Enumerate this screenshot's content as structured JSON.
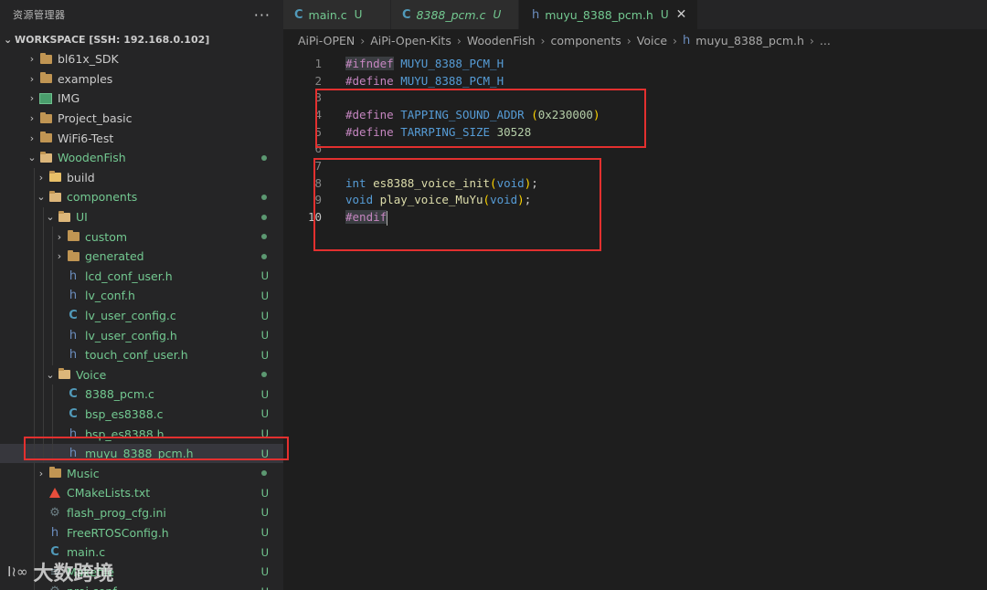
{
  "explorer": {
    "title": "资源管理器",
    "more": "···",
    "workspace": "WORKSPACE [SSH: 192.168.0.102]"
  },
  "tree": [
    {
      "name": "bl61x_SDK",
      "kind": "folder",
      "depth": 1,
      "chev": "›",
      "status": ""
    },
    {
      "name": "examples",
      "kind": "folder",
      "depth": 1,
      "chev": "›",
      "status": ""
    },
    {
      "name": "IMG",
      "kind": "img-folder",
      "depth": 1,
      "chev": "›",
      "status": ""
    },
    {
      "name": "Project_basic",
      "kind": "folder",
      "depth": 1,
      "chev": "›",
      "status": ""
    },
    {
      "name": "WiFi6-Test",
      "kind": "folder",
      "depth": 1,
      "chev": "›",
      "status": ""
    },
    {
      "name": "WoodenFish",
      "kind": "folder-open",
      "depth": 1,
      "chev": "⌄",
      "status": "dot"
    },
    {
      "name": "build",
      "kind": "build-folder",
      "depth": 2,
      "chev": "›",
      "status": ""
    },
    {
      "name": "components",
      "kind": "folder-open",
      "depth": 2,
      "chev": "⌄",
      "status": "dot"
    },
    {
      "name": "UI",
      "kind": "folder-open",
      "depth": 3,
      "chev": "⌄",
      "status": "dot"
    },
    {
      "name": "custom",
      "kind": "folder",
      "depth": 4,
      "chev": "›",
      "status": "dot"
    },
    {
      "name": "generated",
      "kind": "folder",
      "depth": 4,
      "chev": "›",
      "status": "dot"
    },
    {
      "name": "lcd_conf_user.h",
      "kind": "h",
      "depth": 4,
      "chev": "",
      "status": "U"
    },
    {
      "name": "lv_conf.h",
      "kind": "h",
      "depth": 4,
      "chev": "",
      "status": "U"
    },
    {
      "name": "lv_user_config.c",
      "kind": "c",
      "depth": 4,
      "chev": "",
      "status": "U"
    },
    {
      "name": "lv_user_config.h",
      "kind": "h",
      "depth": 4,
      "chev": "",
      "status": "U"
    },
    {
      "name": "touch_conf_user.h",
      "kind": "h",
      "depth": 4,
      "chev": "",
      "status": "U"
    },
    {
      "name": "Voice",
      "kind": "folder-open",
      "depth": 3,
      "chev": "⌄",
      "status": "dot"
    },
    {
      "name": "8388_pcm.c",
      "kind": "c",
      "depth": 4,
      "chev": "",
      "status": "U"
    },
    {
      "name": "bsp_es8388.c",
      "kind": "c",
      "depth": 4,
      "chev": "",
      "status": "U"
    },
    {
      "name": "bsp_es8388.h",
      "kind": "h",
      "depth": 4,
      "chev": "",
      "status": "U"
    },
    {
      "name": "muyu_8388_pcm.h",
      "kind": "h",
      "depth": 4,
      "chev": "",
      "status": "U",
      "selected": true
    },
    {
      "name": "Music",
      "kind": "folder",
      "depth": 2,
      "chev": "›",
      "status": "dot"
    },
    {
      "name": "CMakeLists.txt",
      "kind": "cmake",
      "depth": 2,
      "chev": "",
      "status": "U"
    },
    {
      "name": "flash_prog_cfg.ini",
      "kind": "gear",
      "depth": 2,
      "chev": "",
      "status": "U"
    },
    {
      "name": "FreeRTOSConfig.h",
      "kind": "h",
      "depth": 2,
      "chev": "",
      "status": "U"
    },
    {
      "name": "main.c",
      "kind": "c",
      "depth": 2,
      "chev": "",
      "status": "U"
    },
    {
      "name": "Makefile",
      "kind": "make",
      "depth": 2,
      "chev": "",
      "status": "U"
    },
    {
      "name": "proj.conf",
      "kind": "gear",
      "depth": 2,
      "chev": "",
      "status": "U"
    }
  ],
  "tabs": [
    {
      "icon": "C",
      "label": "main.c",
      "status": "U",
      "active": false,
      "italic": false
    },
    {
      "icon": "C",
      "label": "8388_pcm.c",
      "status": "U",
      "active": false,
      "italic": true
    },
    {
      "icon": "h",
      "label": "muyu_8388_pcm.h",
      "status": "U",
      "active": true,
      "italic": false,
      "close": "✕"
    }
  ],
  "breadcrumb": [
    "AiPi-OPEN",
    "AiPi-Open-Kits",
    "WoodenFish",
    "components",
    "Voice",
    "muyu_8388_pcm.h",
    "..."
  ],
  "code": [
    {
      "n": "1",
      "parts": [
        [
          "pre-hl",
          "#ifndef"
        ],
        [
          "",
          " "
        ],
        [
          "macro",
          "MUYU_8388_PCM_H"
        ]
      ]
    },
    {
      "n": "2",
      "parts": [
        [
          "pre",
          "#define"
        ],
        [
          "",
          " "
        ],
        [
          "macro",
          "MUYU_8388_PCM_H"
        ]
      ]
    },
    {
      "n": "3",
      "parts": []
    },
    {
      "n": "4",
      "parts": [
        [
          "pre",
          "#define"
        ],
        [
          "",
          " "
        ],
        [
          "macro",
          "TAPPING_SOUND_ADDR"
        ],
        [
          "",
          " "
        ],
        [
          "paren",
          "("
        ],
        [
          "num",
          "0x230000"
        ],
        [
          "paren",
          ")"
        ]
      ]
    },
    {
      "n": "5",
      "parts": [
        [
          "pre",
          "#define"
        ],
        [
          "",
          " "
        ],
        [
          "macro",
          "TARRPING_SIZE"
        ],
        [
          "",
          " "
        ],
        [
          "num",
          "30528"
        ]
      ]
    },
    {
      "n": "6",
      "parts": []
    },
    {
      "n": "7",
      "parts": []
    },
    {
      "n": "8",
      "parts": [
        [
          "type",
          "int"
        ],
        [
          "",
          " "
        ],
        [
          "fn",
          "es8388_voice_init"
        ],
        [
          "paren",
          "("
        ],
        [
          "type",
          "void"
        ],
        [
          "paren",
          ")"
        ],
        [
          "",
          ";"
        ]
      ]
    },
    {
      "n": "9",
      "parts": [
        [
          "type",
          "void"
        ],
        [
          "",
          " "
        ],
        [
          "fn",
          "play_voice_MuYu"
        ],
        [
          "paren",
          "("
        ],
        [
          "type",
          "void"
        ],
        [
          "paren",
          ")"
        ],
        [
          "",
          ";"
        ]
      ]
    },
    {
      "n": "10",
      "parts": [
        [
          "pre-hl",
          "#endif"
        ]
      ],
      "current": true
    }
  ],
  "watermark": {
    "logo": "I≀∞",
    "text": "大数跨境"
  },
  "colors": {
    "highlight_box": "#e3302f",
    "untracked": "#73c991",
    "background": "#1e1e1e"
  }
}
